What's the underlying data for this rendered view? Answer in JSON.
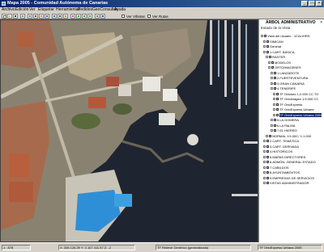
{
  "window": {
    "title": "Mapa 2005 - Comunidad Autónoma de Canarias"
  },
  "menu": [
    "Archivo",
    "Edición",
    "Ver",
    "Etiquetar",
    "Herramientas",
    "Pedidos",
    "GeoConsultas",
    "Ayuda"
  ],
  "toolbar": {
    "check1": "Ver Viñetas",
    "check2": "Ver Rutas"
  },
  "panel": {
    "title": "ÁRBOL ADMINISTRATIVO",
    "subtitle": "Estado de la Vista",
    "items": [
      {
        "label": "Vista del usuario : 1CAL/HRS",
        "indent": 0
      },
      {
        "label": "SIMICAN",
        "indent": 1
      },
      {
        "label": "General",
        "indent": 1
      },
      {
        "label": "1.CART. BÁSICA",
        "indent": 1
      },
      {
        "label": "RASTER",
        "indent": 2
      },
      {
        "label": "MODELOS",
        "indent": 3
      },
      {
        "label": "ORTOIMAGENES",
        "indent": 3
      },
      {
        "label": "1.LANZAROTE",
        "indent": 4
      },
      {
        "label": "2.FUERTEVENTURA",
        "indent": 4
      },
      {
        "label": "3.GRAN CANARIA",
        "indent": 4
      },
      {
        "label": "4.TENERIFE",
        "indent": 4
      },
      {
        "label": "TF Ortofoto 1:2.000 CC TO",
        "indent": 5
      },
      {
        "label": "TF Ortoimagen 1:5.000 CC",
        "indent": 5
      },
      {
        "label": "TF OrtoExpress",
        "indent": 5
      },
      {
        "label": "TF OrtoExpress Urbana",
        "indent": 5
      },
      {
        "label": "TF OrtoExpress Urbana 2005",
        "indent": 5,
        "selected": true
      },
      {
        "label": "5.LA GOMERA",
        "indent": 4
      },
      {
        "label": "6.LA PALMA",
        "indent": 4
      },
      {
        "label": "7.EL HIERRO",
        "indent": 4
      },
      {
        "label": "NORMAL 1:5.000 / 1:1.000",
        "indent": 2
      },
      {
        "label": "2.CART. TEMÁTICA",
        "indent": 1
      },
      {
        "label": "3.CART. DERIVADA",
        "indent": 1
      },
      {
        "label": "4.HISTÓRICOS",
        "indent": 1
      },
      {
        "label": "5.MAPAS DIRECTORES",
        "indent": 1
      },
      {
        "label": "6.ADMÓN. GENERAL ESTADO",
        "indent": 1
      },
      {
        "label": "7.CABILDOS",
        "indent": 1
      },
      {
        "label": "8.AYUNTAMIENTOS",
        "indent": 1
      },
      {
        "label": "9.EMPRESAS DE SERVICIOS",
        "indent": 1
      },
      {
        "label": "VISTAS ADMINISTRADOR",
        "indent": 1
      }
    ]
  },
  "status": {
    "scale": "1 : 878",
    "coords": "X: 336 126.39   Y: 3 107 411.57   Z: -2",
    "layer": "TF Relieve Genérico (generalizado)",
    "layer2": "TF OrtoExpress Urbana 2005"
  },
  "colors": {
    "titlebar": "#0a246a",
    "sea": "#1f2530",
    "selection": "#0a246a"
  }
}
